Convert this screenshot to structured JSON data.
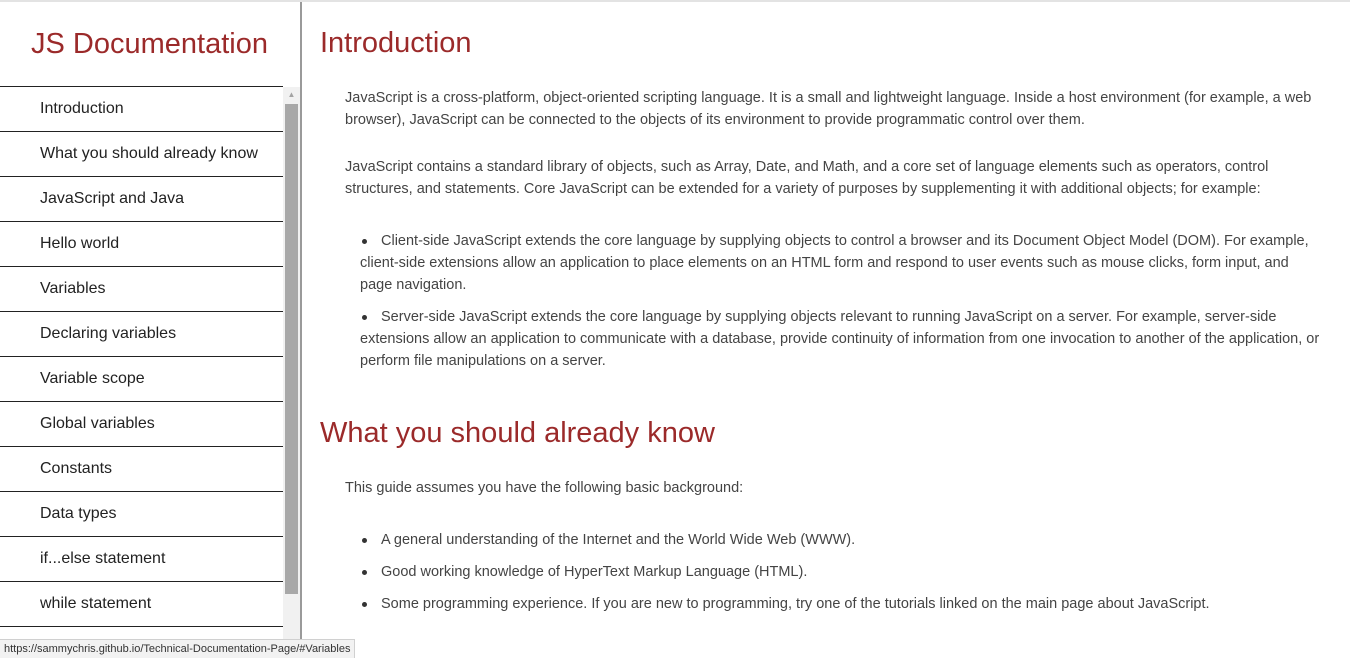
{
  "navbar": {
    "title": "JS Documentation",
    "items": [
      {
        "label": "Introduction"
      },
      {
        "label": "What you should already know"
      },
      {
        "label": "JavaScript and Java"
      },
      {
        "label": "Hello world"
      },
      {
        "label": "Variables"
      },
      {
        "label": "Declaring variables"
      },
      {
        "label": "Variable scope"
      },
      {
        "label": "Global variables"
      },
      {
        "label": "Constants"
      },
      {
        "label": "Data types"
      },
      {
        "label": "if...else statement"
      },
      {
        "label": "while statement"
      }
    ]
  },
  "main": {
    "intro": {
      "title": "Introduction",
      "p1": "JavaScript is a cross-platform, object-oriented scripting language. It is a small and lightweight language. Inside a host environment (for example, a web browser), JavaScript can be connected to the objects of its environment to provide programmatic control over them.",
      "p2": "JavaScript contains a standard library of objects, such as Array, Date, and Math, and a core set of language elements such as operators, control structures, and statements. Core JavaScript can be extended for a variety of purposes by supplementing it with additional objects; for example:",
      "bullets": [
        "Client-side JavaScript extends the core language by supplying objects to control a browser and its Document Object Model (DOM). For example, client-side extensions allow an application to place elements on an HTML form and respond to user events such as mouse clicks, form input, and page navigation.",
        "Server-side JavaScript extends the core language by supplying objects relevant to running JavaScript on a server. For example, server-side extensions allow an application to communicate with a database, provide continuity of information from one invocation to another of the application, or perform file manipulations on a server."
      ]
    },
    "know": {
      "title": "What you should already know",
      "p1": "This guide assumes you have the following basic background:",
      "bullets": [
        "A general understanding of the Internet and the World Wide Web (WWW).",
        "Good working knowledge of HyperText Markup Language (HTML).",
        "Some programming experience. If you are new to programming, try one of the tutorials linked on the main page about JavaScript."
      ]
    }
  },
  "status_bar": {
    "url": "https://sammychris.github.io/Technical-Documentation-Page/#Variables"
  },
  "icons": {
    "scroll_up": "scroll-up-arrow-icon",
    "bullet": "bullet-icon"
  }
}
